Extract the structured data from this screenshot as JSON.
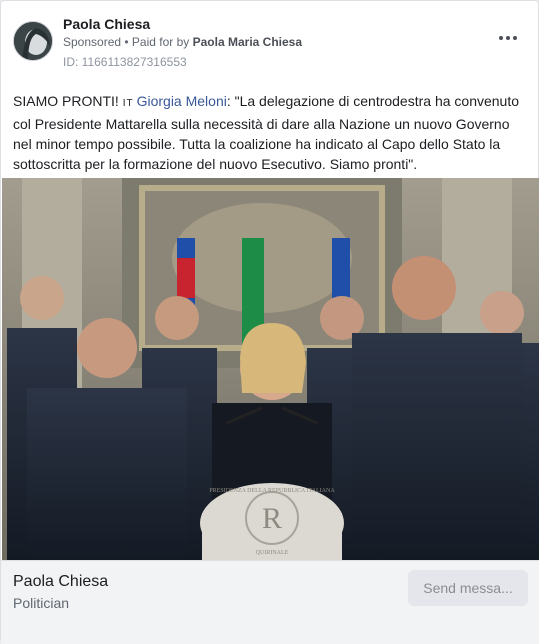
{
  "header": {
    "page_name": "Paola Chiesa",
    "sponsored": "Sponsored",
    "paid_for_prefix": " • Paid for by ",
    "paid_for_by": "Paola Maria Chiesa",
    "ad_id": "ID: 1166113827316553"
  },
  "post": {
    "lead": "SIAMO PRONTI! ",
    "tag": "IT",
    "mention": "Giorgia Meloni",
    "body": ": \"La delegazione di centrodestra ha convenuto col Presidente Mattarella sulla necessità di dare alla Nazione un nuovo Governo nel minor tempo possibile. Tutta la coalizione ha indicato al Capo dello Stato la sottoscritta per la formazione del nuovo Esecutivo. Siamo pronti\"."
  },
  "photo": {
    "lectern_text_top": "PRESIDENZA DELLA REPUBBLICA ITALIANA",
    "lectern_monogram": "R",
    "lectern_text_bottom": "QUIRINALE"
  },
  "footer": {
    "name": "Paola Chiesa",
    "category": "Politician",
    "button": "Send messa..."
  },
  "colors": {
    "link": "#385898",
    "muted": "#606770",
    "button_bg": "#e4e6eb"
  }
}
